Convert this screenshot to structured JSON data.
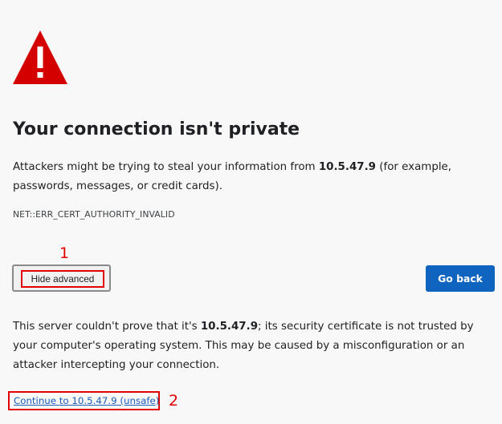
{
  "heading": "Your connection isn't private",
  "description": {
    "prefix": "Attackers might be trying to steal your information from ",
    "host": "10.5.47.9",
    "suffix": " (for example, passwords, messages, or credit cards)."
  },
  "error_code": "NET::ERR_CERT_AUTHORITY_INVALID",
  "buttons": {
    "hide_advanced": "Hide advanced",
    "go_back": "Go back"
  },
  "markers": {
    "first": "1",
    "second": "2"
  },
  "advanced": {
    "prefix": "This server couldn't prove that it's ",
    "host": "10.5.47.9",
    "suffix": "; its security certificate is not trusted by your computer's operating system. This may be caused by a misconfiguration or an attacker intercepting your connection.",
    "continue_link": "Continue to 10.5.47.9 (unsafe)"
  },
  "colors": {
    "warning": "#d40000",
    "annotation": "#e30000",
    "primary_button": "#0f64c0",
    "link": "#1a5bb5"
  },
  "icons": {
    "warning": "warning-triangle-icon"
  }
}
